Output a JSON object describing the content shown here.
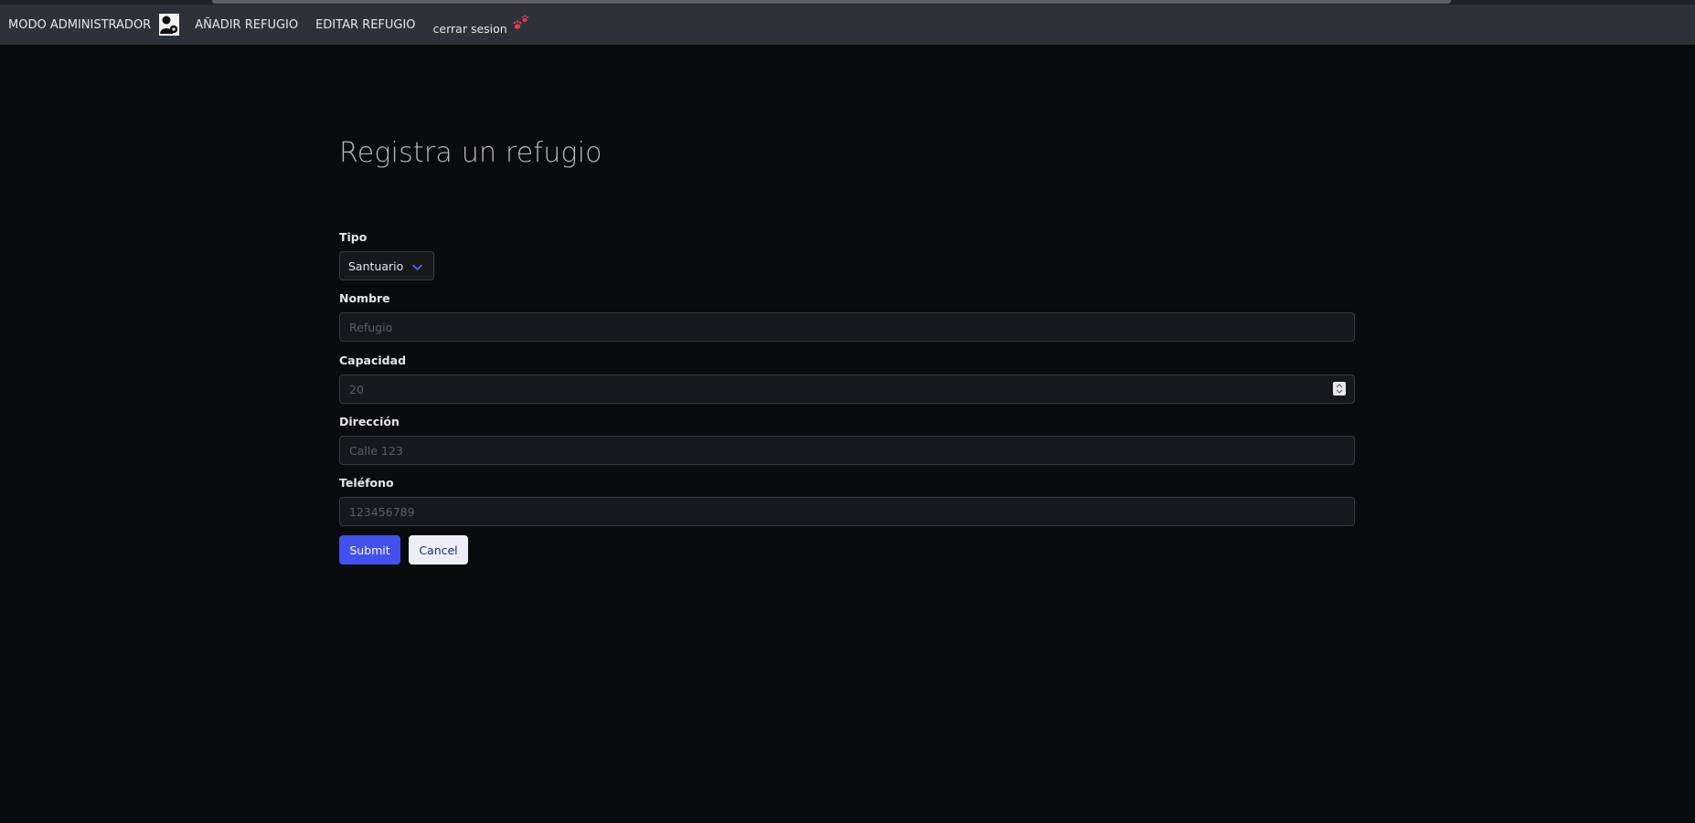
{
  "nav": {
    "admin_label": "MODO ADMINISTRADOR",
    "add_label": "AÑADIR REFUGIO",
    "edit_label": "EDITAR REFUGIO",
    "logout_label": "cerrar sesion",
    "admin_icon": "user-admin-icon",
    "logout_icon": "paw-icon"
  },
  "form": {
    "title": "Registra un refugio",
    "tipo": {
      "label": "Tipo",
      "value": "Santuario"
    },
    "nombre": {
      "label": "Nombre",
      "placeholder": "Refugio"
    },
    "capacidad": {
      "label": "Capacidad",
      "placeholder": "20"
    },
    "direccion": {
      "label": "Dirección",
      "placeholder": "Calle 123"
    },
    "telefono": {
      "label": "Teléfono",
      "placeholder": "123456789"
    },
    "submit_label": "Submit",
    "cancel_label": "Cancel"
  },
  "colors": {
    "background": "#0a0b0d",
    "navbar": "#2d3139",
    "primary": "#4250ee",
    "secondary": "#eceef7"
  }
}
